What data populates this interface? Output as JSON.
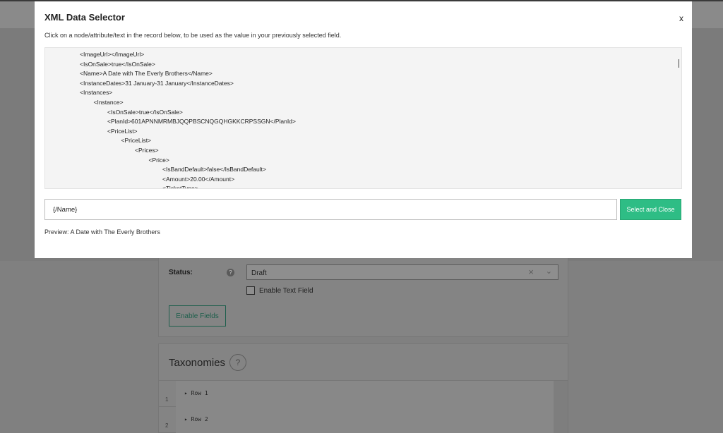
{
  "modal": {
    "title": "XML Data Selector",
    "close_label": "x",
    "description": "Click on a node/attribute/text in the record below, to be used as the value in your previously selected field.",
    "xml_lines": [
      {
        "text": "<ImageUrl></ImageUrl>",
        "indent": 0
      },
      {
        "text": "<IsOnSale>true</IsOnSale>",
        "indent": 0
      },
      {
        "text": "<Name>A Date with The Everly Brothers</Name>",
        "indent": 0
      },
      {
        "text": "<InstanceDates>31 January-31 January</InstanceDates>",
        "indent": 0
      },
      {
        "text": "<Instances>",
        "indent": 0
      },
      {
        "text": "<Instance>",
        "indent": 1
      },
      {
        "text": "<IsOnSale>true</IsOnSale>",
        "indent": 2
      },
      {
        "text": "<PlanId>601APNNMRMBJQQPBSCNQGQHGKKCRPSSGN</PlanId>",
        "indent": 2
      },
      {
        "text": "<PriceList>",
        "indent": 2
      },
      {
        "text": "<PriceList>",
        "indent": 3
      },
      {
        "text": "<Prices>",
        "indent": 4
      },
      {
        "text": "<Price>",
        "indent": 5
      },
      {
        "text": "<IsBandDefault>false</IsBandDefault>",
        "indent": 6
      },
      {
        "text": "<Amount>20.00</Amount>",
        "indent": 6
      },
      {
        "text": "<TicketType>",
        "indent": 6
      }
    ],
    "selected_path": "{/Name}",
    "select_button_label": "Select and Close",
    "preview_text": "Preview: A Date with The Everly Brothers"
  },
  "background": {
    "status": {
      "label": "Status:",
      "help": "?",
      "value": "Draft",
      "clear_icon": "×",
      "chevron_icon": "⌄",
      "checkbox_label": "Enable Text Field",
      "enable_button_label": "Enable Fields"
    },
    "taxonomies": {
      "title": "Taxonomies",
      "help": "?",
      "rows": [
        {
          "num": "1",
          "label": "▸ Row 1"
        },
        {
          "num": "2",
          "label": "▸ Row 2"
        }
      ]
    }
  },
  "colors": {
    "accent": "#2ebd85",
    "overlay": "#808080"
  }
}
